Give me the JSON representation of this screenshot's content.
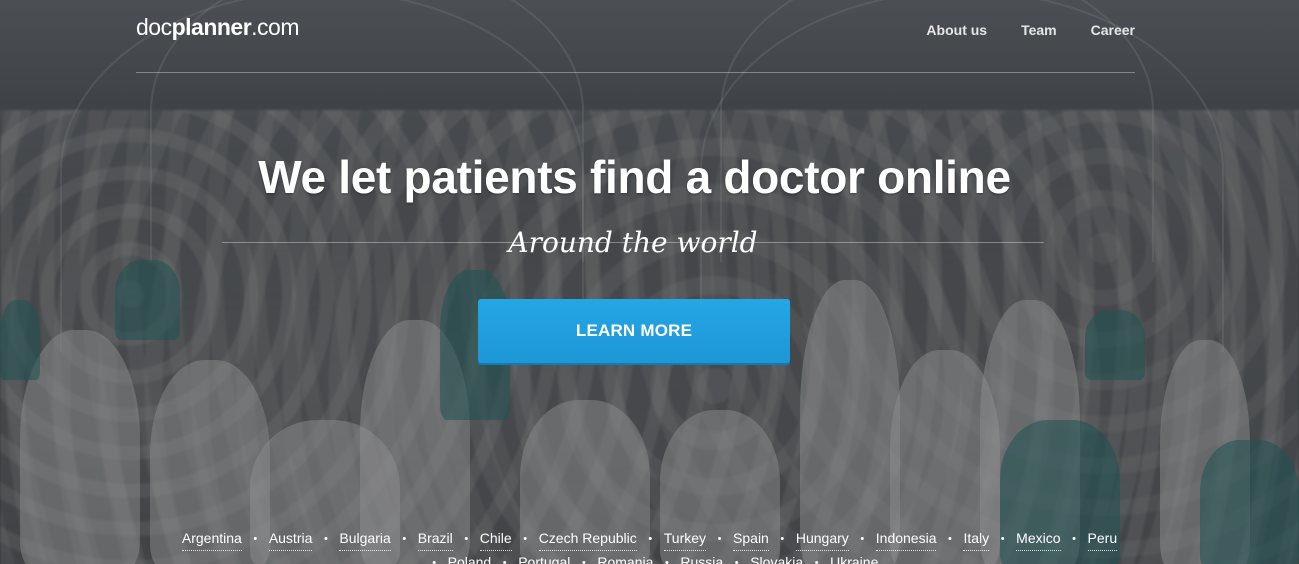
{
  "logo": {
    "part1": "doc",
    "part2": "planner",
    "part3": ".com"
  },
  "nav": {
    "items": [
      "About us",
      "Team",
      "Career"
    ]
  },
  "hero": {
    "headline": "We let patients find a doctor online",
    "subheadline": "Around the world",
    "cta_label": "LEARN MORE"
  },
  "countries": {
    "separator": "•",
    "row1": [
      "Argentina",
      "Austria",
      "Bulgaria",
      "Brazil",
      "Chile",
      "Czech Republic",
      "Turkey",
      "Spain",
      "Hungary",
      "Indonesia",
      "Italy",
      "Mexico",
      "Peru"
    ],
    "row2": [
      "Poland",
      "Portugal",
      "Romania",
      "Russia",
      "Slovakia",
      "Ukraine"
    ]
  },
  "colors": {
    "cta": "#21a0df",
    "text": "#ffffff"
  }
}
